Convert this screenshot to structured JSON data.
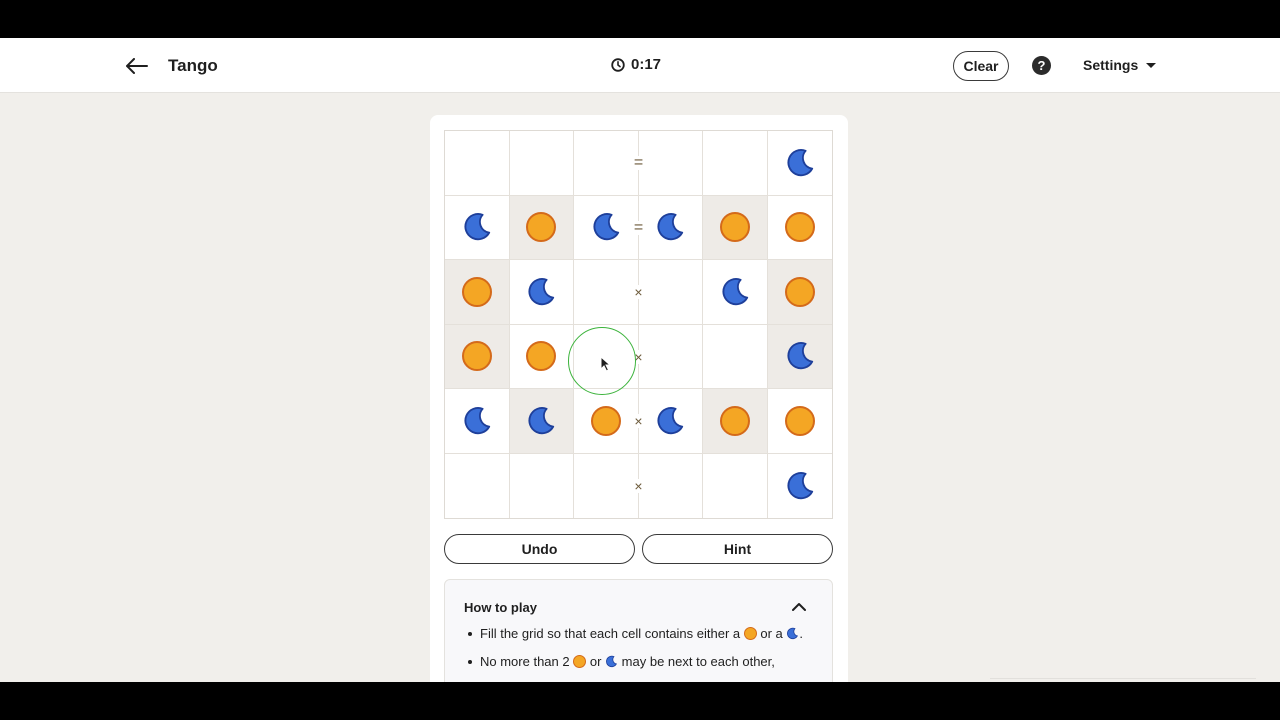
{
  "header": {
    "title": "Tango",
    "timer": "0:17",
    "clear_label": "Clear",
    "help_label": "?",
    "settings_label": "Settings",
    "back_icon": "arrow-left-icon",
    "timer_icon": "clock-icon"
  },
  "board": {
    "rows": 6,
    "cols": 6,
    "cells": [
      [
        "empty",
        "empty",
        "empty",
        "empty",
        "empty",
        "moon"
      ],
      [
        "moon",
        "sun",
        "moon",
        "moon",
        "sun",
        "sun"
      ],
      [
        "sun",
        "moon",
        "empty",
        "empty",
        "moon",
        "sun"
      ],
      [
        "sun",
        "sun",
        "empty",
        "empty",
        "empty",
        "moon"
      ],
      [
        "moon",
        "moon",
        "sun",
        "moon",
        "sun",
        "sun"
      ],
      [
        "empty",
        "empty",
        "empty",
        "empty",
        "empty",
        "moon"
      ]
    ],
    "locked": [
      [
        false,
        false,
        false,
        false,
        false,
        false
      ],
      [
        false,
        true,
        false,
        false,
        true,
        false
      ],
      [
        true,
        false,
        false,
        false,
        false,
        true
      ],
      [
        true,
        false,
        false,
        false,
        false,
        true
      ],
      [
        false,
        true,
        false,
        false,
        true,
        false
      ],
      [
        false,
        false,
        false,
        false,
        false,
        false
      ]
    ],
    "constraints": [
      {
        "row": 0,
        "col": 2,
        "symbol": "="
      },
      {
        "row": 1,
        "col": 2,
        "symbol": "="
      },
      {
        "row": 2,
        "col": 2,
        "symbol": "×"
      },
      {
        "row": 3,
        "col": 2,
        "symbol": "×"
      },
      {
        "row": 4,
        "col": 2,
        "symbol": "×"
      },
      {
        "row": 5,
        "col": 2,
        "symbol": "×"
      }
    ],
    "colors": {
      "sun_fill": "#f4a624",
      "sun_border": "#d46a1a",
      "moon_fill": "#3a6fd8",
      "moon_border": "#1e3f9a"
    }
  },
  "controls": {
    "undo_label": "Undo",
    "hint_label": "Hint"
  },
  "how_to_play": {
    "title": "How to play",
    "rule1_a": "Fill the grid so that each cell contains either a",
    "rule1_b": "or a",
    "rule1_c": ".",
    "rule2_a": "No more than 2",
    "rule2_b": "or",
    "rule2_c": "may be next to each other,"
  }
}
